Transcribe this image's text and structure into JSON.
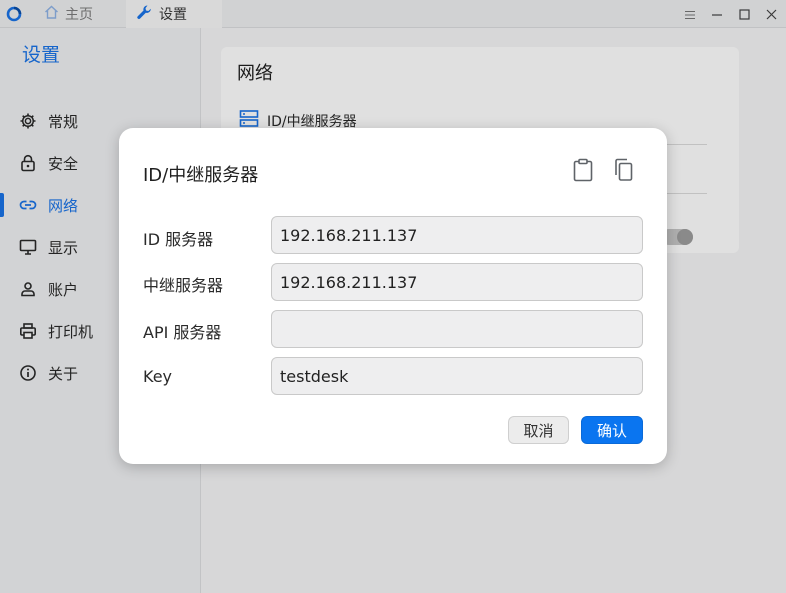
{
  "titlebar": {
    "tabs": [
      {
        "label": "主页",
        "icon": "home-icon"
      },
      {
        "label": "设置",
        "icon": "wrench-icon"
      }
    ],
    "controls": [
      "menu-icon",
      "minimize-icon",
      "maximize-icon",
      "close-icon"
    ]
  },
  "sidebar": {
    "title": "设置",
    "items": [
      {
        "label": "常规",
        "icon": "gear-icon"
      },
      {
        "label": "安全",
        "icon": "lock-icon"
      },
      {
        "label": "网络",
        "icon": "link-icon",
        "active": true
      },
      {
        "label": "显示",
        "icon": "monitor-icon"
      },
      {
        "label": "账户",
        "icon": "person-icon"
      },
      {
        "label": "打印机",
        "icon": "printer-icon"
      },
      {
        "label": "关于",
        "icon": "info-icon"
      }
    ]
  },
  "main": {
    "card": {
      "title": "网络",
      "row_label": "ID/中继服务器"
    }
  },
  "dialog": {
    "title": "ID/中继服务器",
    "fields": [
      {
        "label": "ID 服务器",
        "value": "192.168.211.137"
      },
      {
        "label": "中继服务器",
        "value": "192.168.211.137"
      },
      {
        "label": "API 服务器",
        "value": ""
      },
      {
        "label": "Key",
        "value": "testdesk"
      }
    ],
    "cancel_label": "取消",
    "ok_label": "确认"
  },
  "colors": {
    "accent": "#1a73e8",
    "button_primary": "#0a75f0"
  }
}
